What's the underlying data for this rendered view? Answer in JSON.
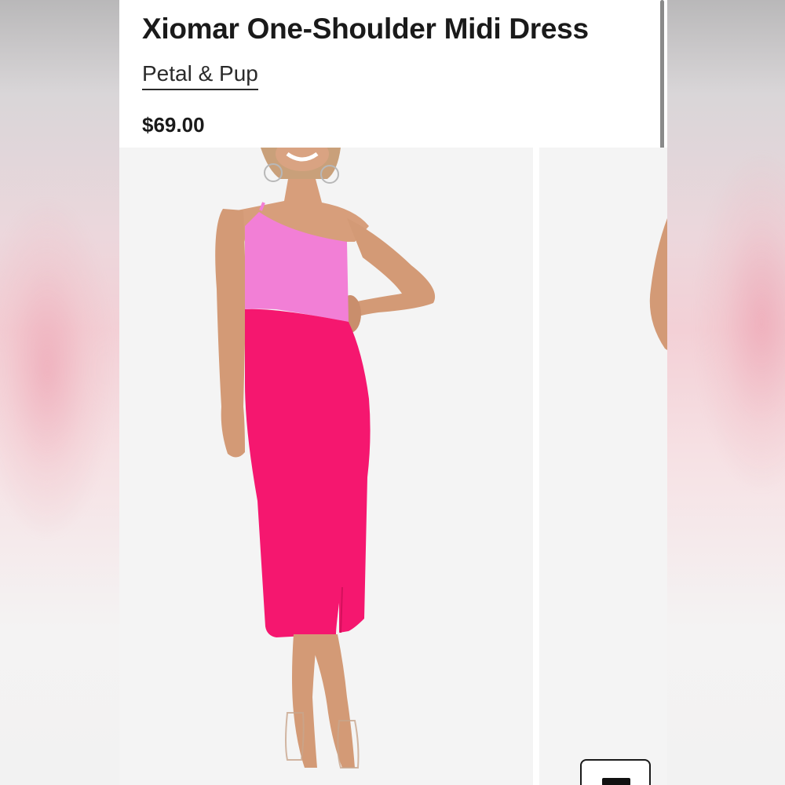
{
  "product": {
    "title": "Xiomar One-Shoulder Midi Dress",
    "brand": "Petal & Pup",
    "price": "$69.00"
  },
  "gallery": {
    "slides": [
      {
        "name": "main-product-photo",
        "subject": "model wearing two-tone pink one-shoulder midi dress"
      },
      {
        "name": "next-product-photo-peek",
        "subject": "partial view of next product photo"
      }
    ],
    "overlay_icon": "view-toggle-icon"
  },
  "colors": {
    "bodice_pink": "#f27fd6",
    "skirt_fuchsia": "#f5176f",
    "text": "#1a1a1a",
    "photo_bg": "#f4f4f4"
  }
}
